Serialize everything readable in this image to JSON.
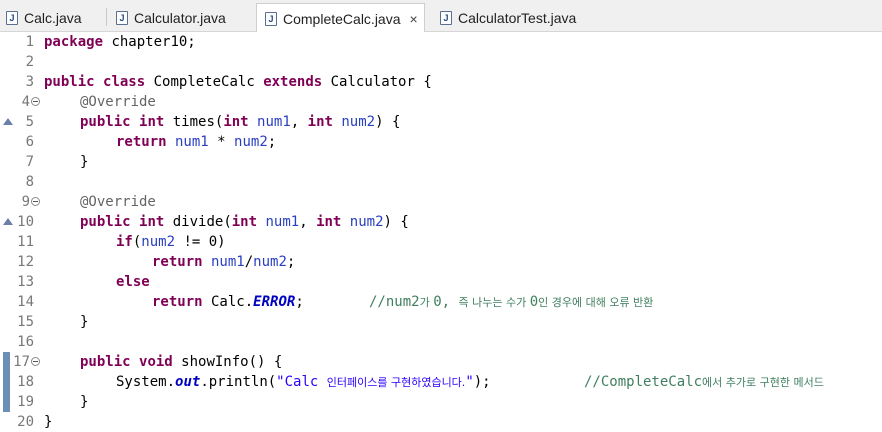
{
  "tabs": [
    {
      "label": "Calc.java",
      "icon": "java-file-icon",
      "active": false
    },
    {
      "label": "Calculator.java",
      "icon": "java-file-icon",
      "active": false
    },
    {
      "label": "CompleteCalc.java",
      "icon": "java-file-icon",
      "active": true,
      "close": "×"
    },
    {
      "label": "CalculatorTest.java",
      "icon": "java-file-icon",
      "active": false
    }
  ],
  "icon_glyph": "J",
  "line_numbers": [
    "1",
    "2",
    "3",
    "4",
    "5",
    "6",
    "7",
    "8",
    "9",
    "10",
    "11",
    "12",
    "13",
    "14",
    "15",
    "16",
    "17",
    "18",
    "19",
    "20"
  ],
  "code": {
    "l1": {
      "kw": "package",
      "rest": " chapter10;"
    },
    "l3": {
      "kw1": "public",
      "kw2": "class",
      "name": " CompleteCalc ",
      "kw3": "extends",
      "rest": " Calculator {"
    },
    "l4": {
      "ann": "@Override"
    },
    "l5": {
      "kw1": "public",
      "kw2": "int",
      "a": " times(",
      "kw3": "int",
      "v1": " num1",
      "b": ", ",
      "kw4": "int",
      "v2": " num2",
      "c": ") {"
    },
    "l6": {
      "kw": "return",
      "v1": " num1",
      "op": " * ",
      "v2": "num2",
      "end": ";"
    },
    "l7": {
      "text": "}"
    },
    "l9": {
      "ann": "@Override"
    },
    "l10": {
      "kw1": "public",
      "kw2": "int",
      "a": " divide(",
      "kw3": "int",
      "v1": " num1",
      "b": ", ",
      "kw4": "int",
      "v2": " num2",
      "c": ") {"
    },
    "l11": {
      "kw": "if",
      "a": "(",
      "v": "num2",
      "b": " != 0)"
    },
    "l12": {
      "kw": "return",
      "v1": " num1",
      "op": "/",
      "v2": "num2",
      "end": ";"
    },
    "l13": {
      "kw": "else"
    },
    "l14": {
      "kw": "return",
      "a": " Calc.",
      "const": "ERROR",
      "b": ";",
      "com1": "//num2",
      "com_ko1": "가 ",
      "com2": "0, ",
      "com_ko2": "즉 나누는 수가 ",
      "com3": "0",
      "com_ko3": "인 경우에 대해 오류 반환"
    },
    "l15": {
      "text": "}"
    },
    "l17": {
      "kw1": "public",
      "kw2": "void",
      "rest": " showInfo() {"
    },
    "l18": {
      "a": "System.",
      "static": "out",
      "b": ".println(",
      "str1": "\"Calc ",
      "str_ko": "인터페이스를 구현하였습니다.",
      "str2": "\"",
      "c": ");",
      "com1": "//CompleteCalc",
      "com_ko": "에서 추가로 구현한 메서드"
    },
    "l19": {
      "text": "}"
    },
    "l20": {
      "text": "}"
    }
  },
  "colors": {
    "keyword": "#7f0055",
    "annotation": "#646464",
    "variable": "#2a3fc0",
    "string": "#2a00ff",
    "comment": "#3f7f5f",
    "constant": "#0000c0",
    "line_number": "#787878"
  }
}
